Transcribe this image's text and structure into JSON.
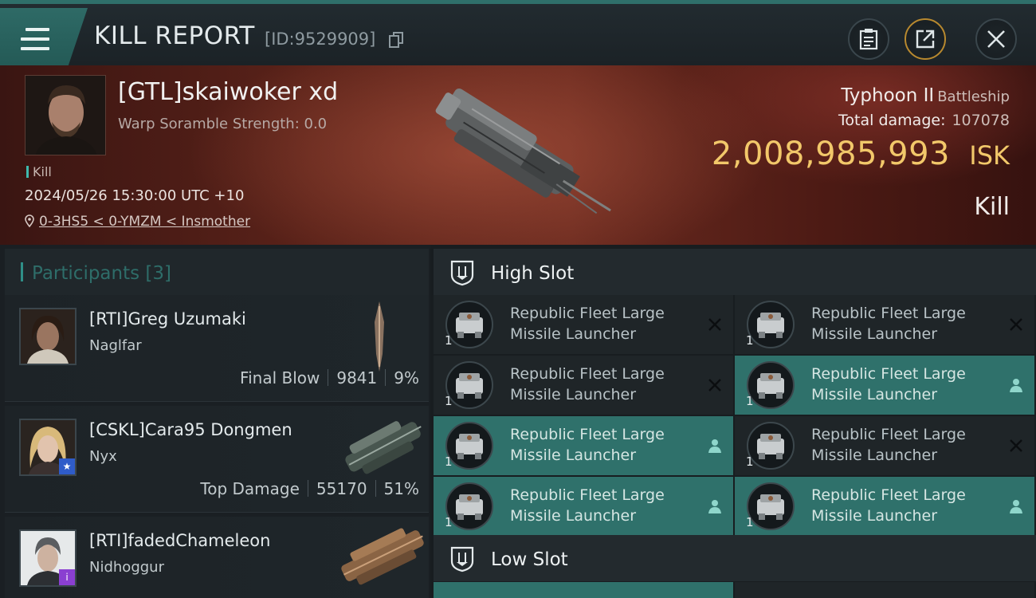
{
  "header": {
    "title": "KILL REPORT",
    "report_id": "[ID:9529909]"
  },
  "victim": {
    "name": "[GTL]skaiwoker xd",
    "warp_scramble": "Warp Soramble Strength: 0.0",
    "tag": "Kill",
    "datetime": "2024/05/26 15:30:00 UTC +10",
    "location": "0-3HS5 < 0-YMZM < Insmother",
    "ship": "Typhoon II",
    "ship_class": "Battleship",
    "total_damage_label": "Total damage:",
    "total_damage": "107078",
    "isk_value": "2,008,985,993",
    "isk_unit": "ISK",
    "result": "Kill"
  },
  "participants": {
    "title": "Participants",
    "count": "[3]",
    "list": [
      {
        "name": "[RTI]Greg Uzumaki",
        "ship": "Naglfar",
        "role": "Final Blow",
        "damage": "9841",
        "percent": "9%"
      },
      {
        "name": "[CSKL]Cara95 Dongmen",
        "ship": "Nyx",
        "role": "Top Damage",
        "damage": "55170",
        "percent": "51%"
      },
      {
        "name": "[RTI]fadedChameleon",
        "ship": "Nidhoggur",
        "role": "",
        "damage": "",
        "percent": ""
      }
    ]
  },
  "slots": {
    "high_title": "High Slot",
    "low_title": "Low Slot",
    "high_modules": [
      {
        "line1": "Republic Fleet Large",
        "line2": "Missile Launcher",
        "qty": "1",
        "state": "destroyed"
      },
      {
        "line1": "Republic Fleet Large",
        "line2": "Missile Launcher",
        "qty": "1",
        "state": "destroyed"
      },
      {
        "line1": "Republic Fleet Large",
        "line2": "Missile Launcher",
        "qty": "1",
        "state": "destroyed"
      },
      {
        "line1": "Republic Fleet Large",
        "line2": "Missile Launcher",
        "qty": "1",
        "state": "dropped"
      },
      {
        "line1": "Republic Fleet Large",
        "line2": "Missile Launcher",
        "qty": "1",
        "state": "dropped"
      },
      {
        "line1": "Republic Fleet Large",
        "line2": "Missile Launcher",
        "qty": "1",
        "state": "destroyed"
      },
      {
        "line1": "Republic Fleet Large",
        "line2": "Missile Launcher",
        "qty": "1",
        "state": "dropped"
      },
      {
        "line1": "Republic Fleet Large",
        "line2": "Missile Launcher",
        "qty": "1",
        "state": "dropped"
      }
    ]
  },
  "colors": {
    "accent_teal": "#2f716b",
    "isk_gold": "#f2c86a",
    "banner_red": "#5a2219"
  },
  "icons": [
    "menu-icon",
    "copy-icon",
    "clipboard-icon",
    "share-icon",
    "close-icon",
    "location-pin-icon",
    "shield-slot-icon",
    "launcher-icon",
    "destroyed-x-icon",
    "dropped-person-icon",
    "star-badge-icon",
    "info-badge-icon"
  ]
}
